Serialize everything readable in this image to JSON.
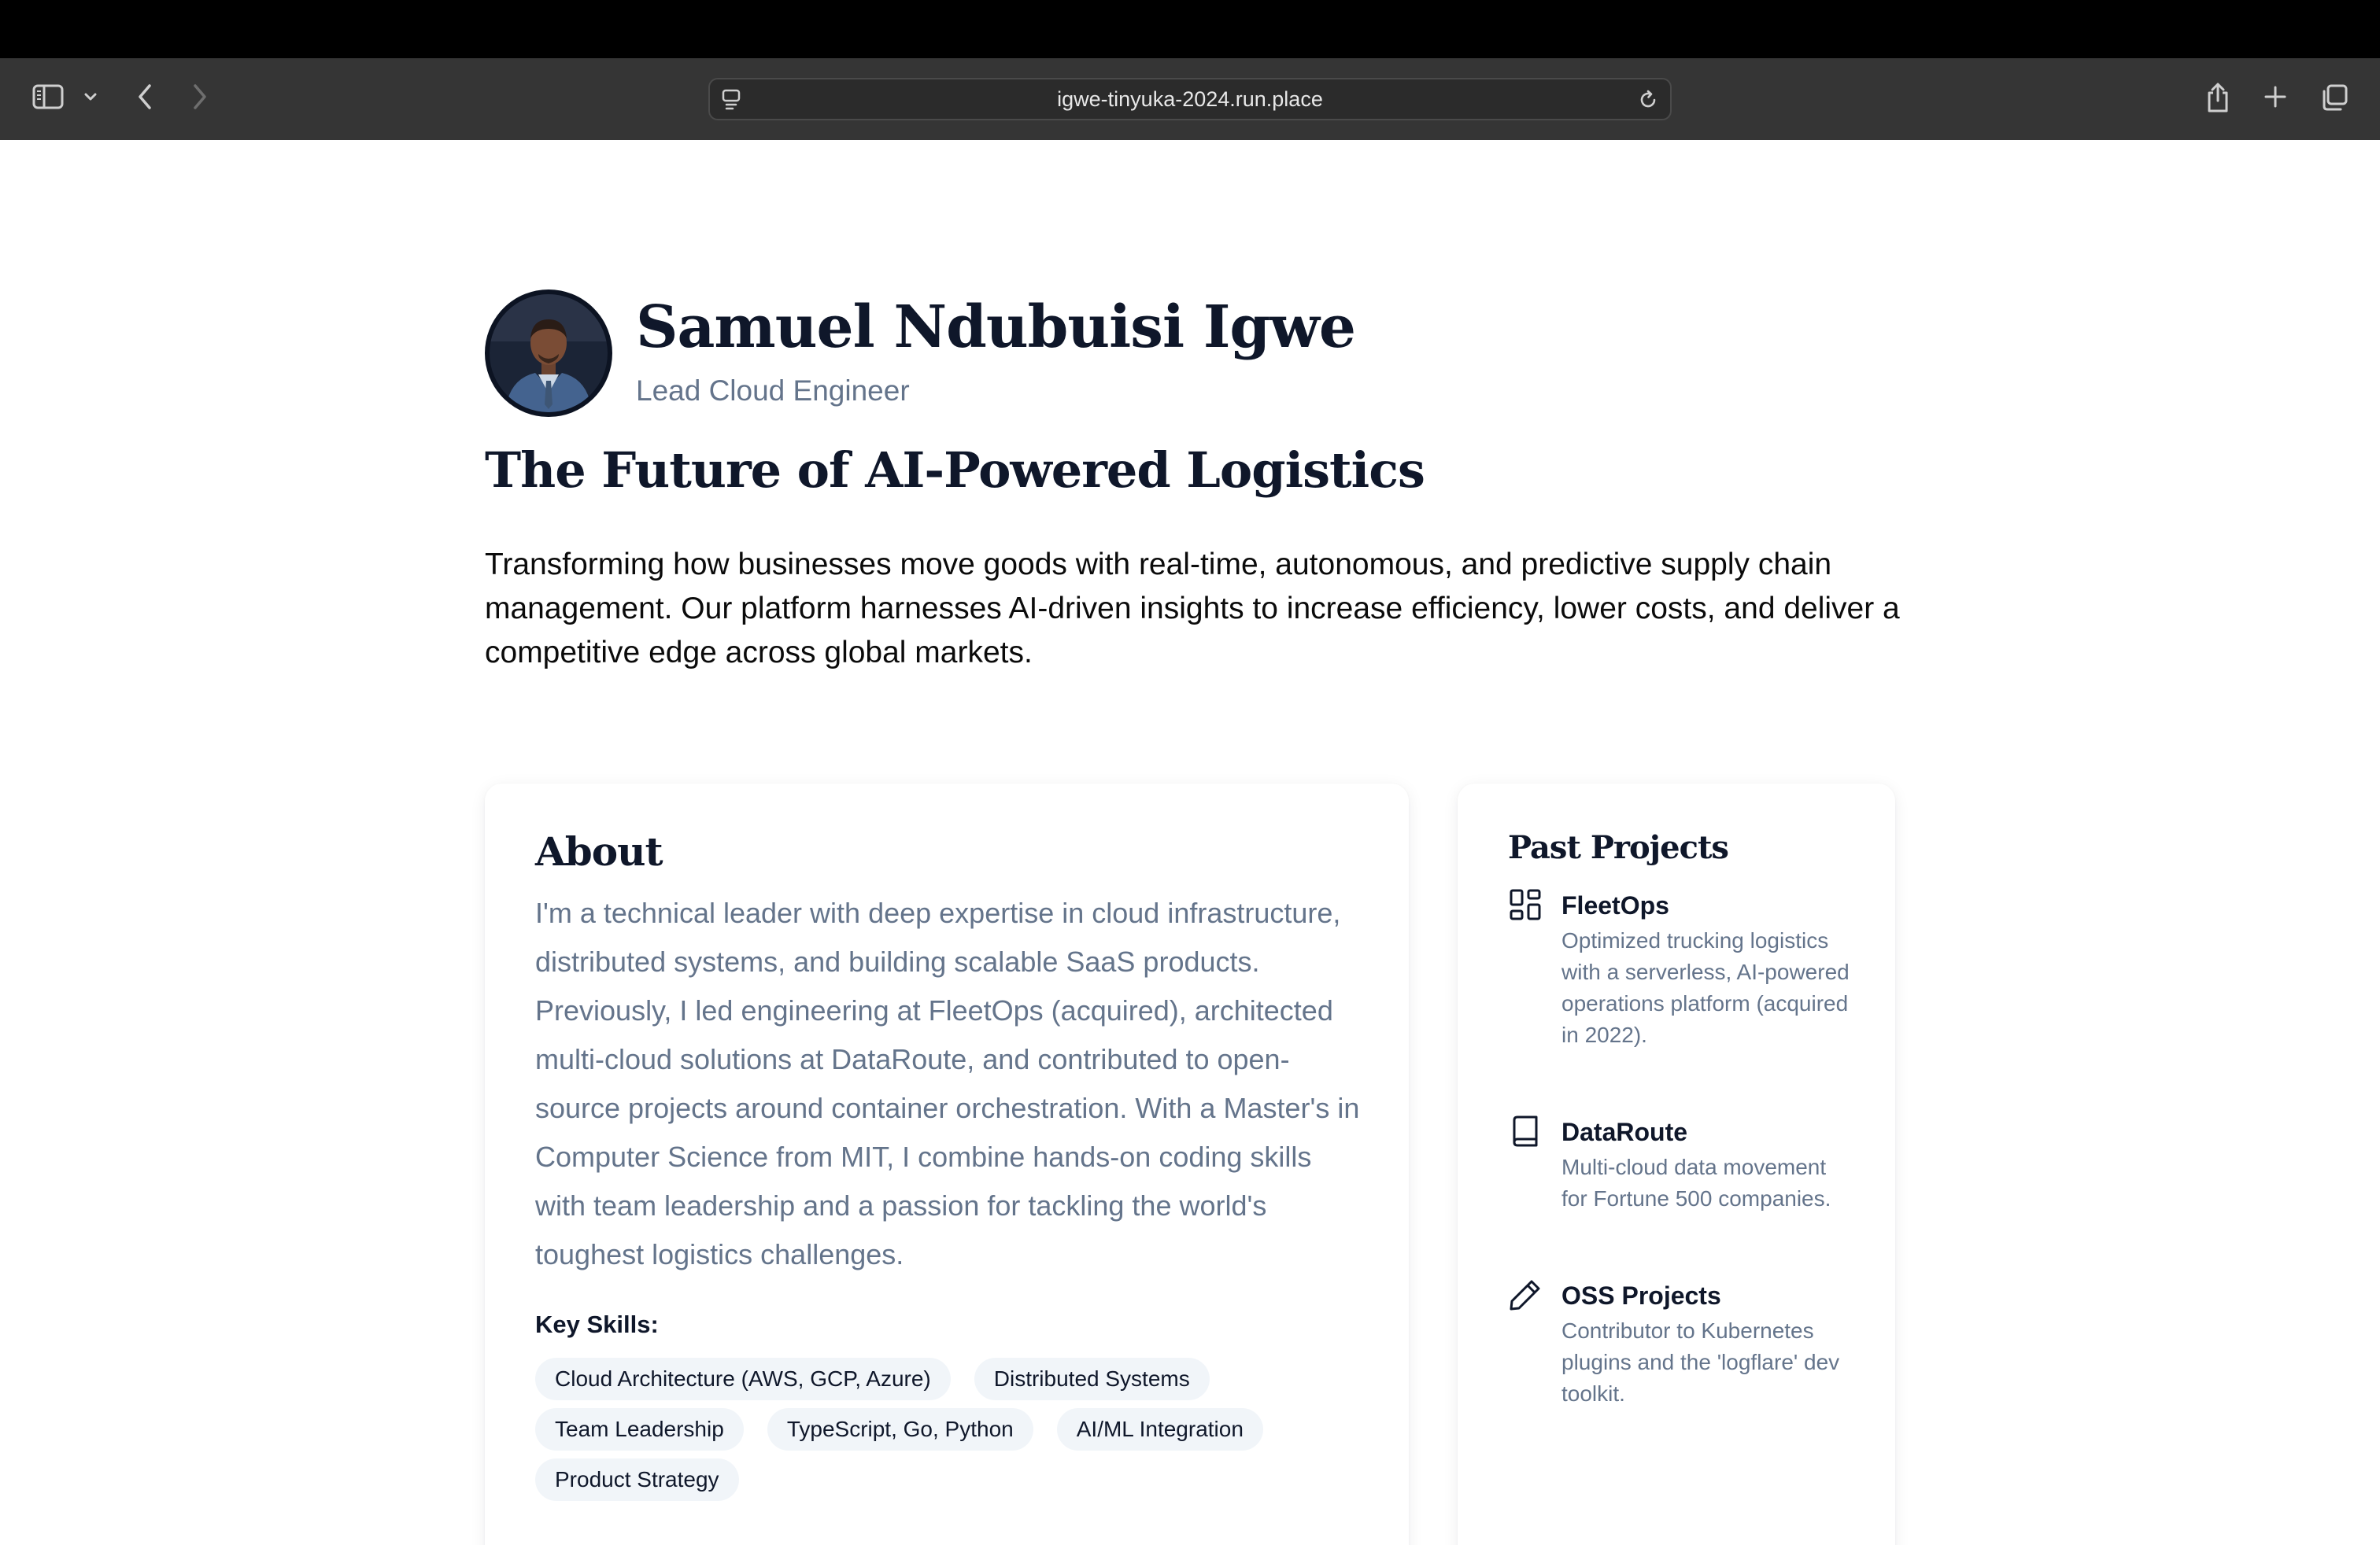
{
  "browser": {
    "url": "igwe-tinyuka-2024.run.place",
    "icons": [
      "sidebar-icon",
      "chevron-down-icon",
      "back-icon",
      "forward-icon",
      "page-menu-icon",
      "reload-icon",
      "share-icon",
      "new-tab-icon",
      "tabs-overview-icon"
    ]
  },
  "profile": {
    "name": "Samuel Ndubuisi Igwe",
    "role": "Lead Cloud Engineer"
  },
  "hero": {
    "headline": "The Future of AI-Powered Logistics",
    "intro": "Transforming how businesses move goods with real-time, autonomous, and predictive supply chain management. Our platform harnesses AI-driven insights to increase efficiency, lower costs, and deliver a competitive edge across global markets."
  },
  "about": {
    "title": "About",
    "text": "I'm a technical leader with deep expertise in cloud infrastructure, distributed systems, and building scalable SaaS products. Previously, I led engineering at FleetOps (acquired), architected multi-cloud solutions at DataRoute, and contributed to open-source projects around container orchestration. With a Master's in Computer Science from MIT, I combine hands-on coding skills with team leadership and a passion for tackling the world's toughest logistics challenges.",
    "skills_title": "Key Skills:",
    "skills": [
      "Cloud Architecture (AWS, GCP, Azure)",
      "Distributed Systems",
      "Team Leadership",
      "TypeScript, Go, Python",
      "AI/ML Integration",
      "Product Strategy"
    ]
  },
  "projects": {
    "title": "Past Projects",
    "items": [
      {
        "name": "FleetOps",
        "icon": "dashboard-icon",
        "description": "Optimized trucking logistics with a serverless, AI-powered operations platform (acquired in 2022)."
      },
      {
        "name": "DataRoute",
        "icon": "book-icon",
        "description": "Multi-cloud data movement for Fortune 500 companies."
      },
      {
        "name": "OSS Projects",
        "icon": "pencil-icon",
        "description": "Contributor to Kubernetes plugins and the 'logflare' dev toolkit."
      }
    ]
  },
  "colors": {
    "heading": "#0f172a",
    "muted": "#64748b",
    "chip_bg": "#f1f5f9",
    "toolbar": "#353535"
  }
}
